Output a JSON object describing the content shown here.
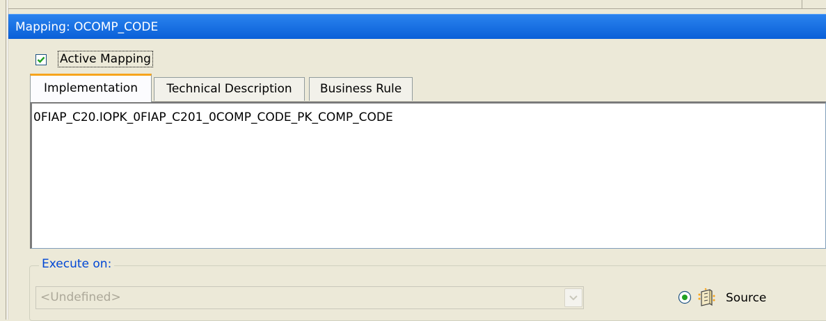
{
  "window": {
    "title": "Mapping: OCOMP_CODE"
  },
  "active_mapping": {
    "label": "Active Mapping",
    "checked": true
  },
  "tabs": [
    {
      "label": "Implementation",
      "selected": true
    },
    {
      "label": "Technical Description",
      "selected": false
    },
    {
      "label": "Business Rule",
      "selected": false
    }
  ],
  "implementation": {
    "text": "0FIAP_C20.IOPK_0FIAP_C201_0COMP_CODE_PK_COMP_CODE"
  },
  "execute_on": {
    "legend": "Execute on:",
    "selected_value": "<Undefined>",
    "enabled": false,
    "radio_label": "Source",
    "radio_selected": true
  },
  "colors": {
    "title_bar": "#0a60d8",
    "tab_accent": "#f7a41c",
    "legend_text": "#0046d5",
    "checkbox_mark": "#21a121"
  }
}
